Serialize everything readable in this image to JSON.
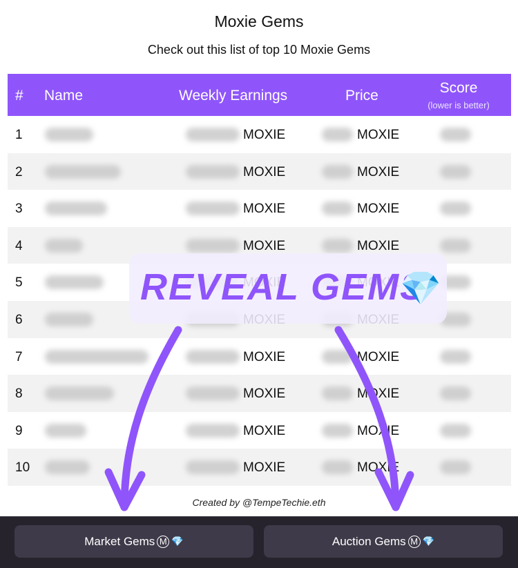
{
  "header": {
    "title": "Moxie Gems",
    "subtitle": "Check out this list of top 10 Moxie Gems"
  },
  "table": {
    "columns": {
      "rank": "#",
      "name": "Name",
      "weekly_earnings": "Weekly Earnings",
      "price": "Price",
      "score": "Score",
      "score_note": "(lower is better)"
    },
    "currency": "MOXIE",
    "rows": [
      {
        "rank": "1"
      },
      {
        "rank": "2"
      },
      {
        "rank": "3"
      },
      {
        "rank": "4"
      },
      {
        "rank": "5"
      },
      {
        "rank": "6"
      },
      {
        "rank": "7"
      },
      {
        "rank": "8"
      },
      {
        "rank": "9"
      },
      {
        "rank": "10"
      }
    ]
  },
  "overlay": {
    "label": "REVEAL GEMS",
    "icon": "gem-icon",
    "accent_color": "#8f55fb"
  },
  "credit": "Created by @TempeTechie.eth",
  "footer": {
    "buttons": [
      {
        "label": "Market Gems",
        "badge": "M",
        "icon": "gem-icon"
      },
      {
        "label": "Auction Gems",
        "badge": "M",
        "icon": "gem-icon"
      }
    ]
  }
}
